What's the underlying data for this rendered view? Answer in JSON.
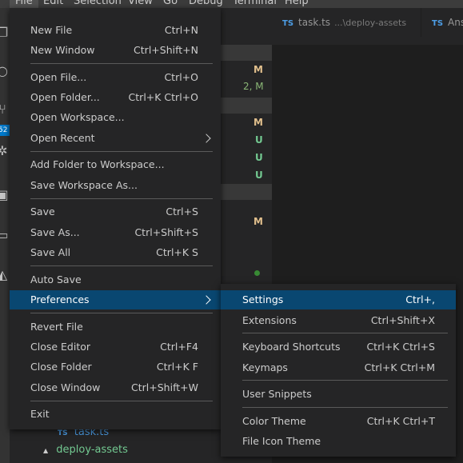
{
  "menubar": [
    "File",
    "Edit",
    "Selection",
    "View",
    "Go",
    "Debug",
    "Terminal",
    "Help"
  ],
  "tabs": [
    {
      "icon": "TS",
      "name": "task.ts",
      "desc": "...\\deploy-assets"
    },
    {
      "icon": "TS",
      "name": "Ans",
      "desc": ""
    }
  ],
  "sidebar": {
    "badges": [
      "M",
      "2, M",
      "M",
      "U",
      "U",
      "U",
      "M"
    ],
    "scm_count": "52",
    "tree": [
      {
        "icon": "TS",
        "label": "task.ts"
      },
      {
        "icon": "▲",
        "label": "deploy-assets"
      }
    ]
  },
  "file_menu": {
    "items": [
      {
        "label": "New File",
        "key": "Ctrl+N"
      },
      {
        "label": "New Window",
        "key": "Ctrl+Shift+N"
      },
      {
        "label": "Open File...",
        "key": "Ctrl+O"
      },
      {
        "label": "Open Folder...",
        "key": "Ctrl+K Ctrl+O"
      },
      {
        "label": "Open Workspace...",
        "key": ""
      },
      {
        "label": "Open Recent",
        "key": ""
      },
      {
        "label": "Add Folder to Workspace...",
        "key": ""
      },
      {
        "label": "Save Workspace As...",
        "key": ""
      },
      {
        "label": "Save",
        "key": "Ctrl+S"
      },
      {
        "label": "Save As...",
        "key": "Ctrl+Shift+S"
      },
      {
        "label": "Save All",
        "key": "Ctrl+K S"
      },
      {
        "label": "Auto Save",
        "key": ""
      },
      {
        "label": "Preferences",
        "key": ""
      },
      {
        "label": "Revert File",
        "key": ""
      },
      {
        "label": "Close Editor",
        "key": "Ctrl+F4"
      },
      {
        "label": "Close Folder",
        "key": "Ctrl+K F"
      },
      {
        "label": "Close Window",
        "key": "Ctrl+Shift+W"
      },
      {
        "label": "Exit",
        "key": ""
      }
    ]
  },
  "prefs_menu": {
    "items": [
      {
        "label": "Settings",
        "key": "Ctrl+,"
      },
      {
        "label": "Extensions",
        "key": "Ctrl+Shift+X"
      },
      {
        "label": "Keyboard Shortcuts",
        "key": "Ctrl+K Ctrl+S"
      },
      {
        "label": "Keymaps",
        "key": "Ctrl+K Ctrl+M"
      },
      {
        "label": "User Snippets",
        "key": ""
      },
      {
        "label": "Color Theme",
        "key": "Ctrl+K Ctrl+T"
      },
      {
        "label": "File Icon Theme",
        "key": ""
      }
    ]
  },
  "colors": {
    "accent": "#094771",
    "modified": "#e2c08d",
    "untracked": "#73c991",
    "ts": "#4d9ee6"
  }
}
